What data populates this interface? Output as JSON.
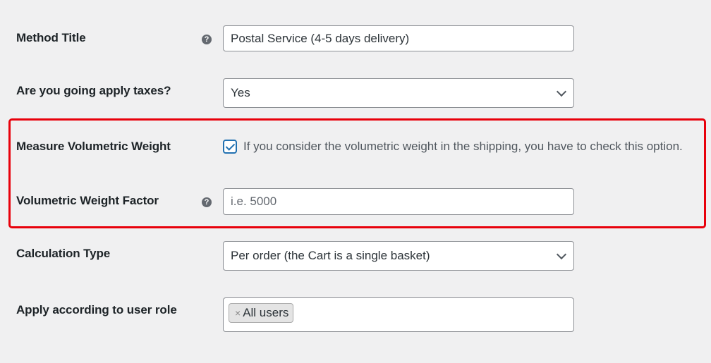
{
  "fields": {
    "method_title": {
      "label": "Method Title",
      "value": "Postal Service (4-5 days delivery)",
      "help_icon": "question-circle-icon"
    },
    "apply_taxes": {
      "label": "Are you going apply taxes?",
      "value": "Yes"
    },
    "measure_volumetric_weight": {
      "label": "Measure Volumetric Weight",
      "checked": true,
      "description": "If you consider the volumetric weight in the shipping, you have to check this option."
    },
    "volumetric_weight_factor": {
      "label": "Volumetric Weight Factor",
      "value": "",
      "placeholder": "i.e. 5000",
      "help_icon": "question-circle-icon"
    },
    "calculation_type": {
      "label": "Calculation Type",
      "value": "Per order (the Cart is a single basket)"
    },
    "user_role": {
      "label": "Apply according to user role",
      "tags": [
        {
          "remove": "×",
          "label": "All users"
        }
      ]
    }
  },
  "colors": {
    "highlight": "#e8000b",
    "checkbox_accent": "#2271b1"
  }
}
